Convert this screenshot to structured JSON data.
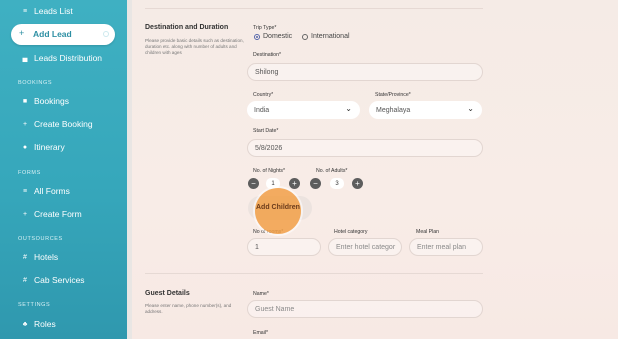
{
  "sidebar": {
    "items": [
      {
        "label": "Leads List",
        "icon": "list-icon",
        "glyph": "≡"
      },
      {
        "label": "Leads Distribution",
        "icon": "bar-chart-icon",
        "glyph": "▄"
      },
      {
        "label": "Bookings",
        "icon": "bookings-icon",
        "glyph": "■"
      },
      {
        "label": "Create Booking",
        "icon": "plus-icon",
        "glyph": "+"
      },
      {
        "label": "Itinerary",
        "icon": "itinerary-icon",
        "glyph": "●"
      },
      {
        "label": "All Forms",
        "icon": "list-icon",
        "glyph": "≡"
      },
      {
        "label": "Create Form",
        "icon": "plus-icon",
        "glyph": "+"
      },
      {
        "label": "Hotels",
        "icon": "hotel-icon",
        "glyph": "#"
      },
      {
        "label": "Cab Services",
        "icon": "cab-icon",
        "glyph": "#"
      },
      {
        "label": "Roles",
        "icon": "roles-icon",
        "glyph": "♣"
      }
    ],
    "active": {
      "label": "Add Lead",
      "icon": "plus-icon",
      "glyph": "+"
    },
    "sections": {
      "bookings": "BOOKINGS",
      "forms": "FORMS",
      "outsources": "OUTSOURCES",
      "settings": "SETTINGS"
    }
  },
  "destination": {
    "title": "Destination and Duration",
    "description": "Please provide basic details such as destination, duration etc. along with number of adults and children with ages",
    "trip_type_label": "Trip Type*",
    "trip_options": [
      "Domestic",
      "International"
    ],
    "trip_selected": "Domestic",
    "destination_label": "Destination*",
    "destination_value": "Shilong",
    "country_label": "Country*",
    "country_value": "India",
    "state_label": "State/Province*",
    "state_value": "Meghalaya",
    "start_date_label": "Start Date*",
    "start_date_value": "5/8/2026",
    "nights_label": "No. of Nights*",
    "nights_value": "1",
    "adults_label": "No. of Adults*",
    "adults_value": "3",
    "add_children_label": "Add Children",
    "rooms_label": "No of rooms*",
    "rooms_value": "1",
    "hotel_category_label": "Hotel category",
    "hotel_category_placeholder": "Enter hotel categor",
    "meal_plan_label": "Meal Plan",
    "meal_plan_placeholder": "Enter meal plan"
  },
  "guest": {
    "title": "Guest Details",
    "description": "Please enter name, phone number(s), and address.",
    "name_label": "Name*",
    "name_placeholder": "Guest Name",
    "email_label": "Email*"
  },
  "colors": {
    "sidebar_teal": "#36a7bb",
    "accent_orange": "#f2a048",
    "form_bg": "#f7ebe6"
  }
}
